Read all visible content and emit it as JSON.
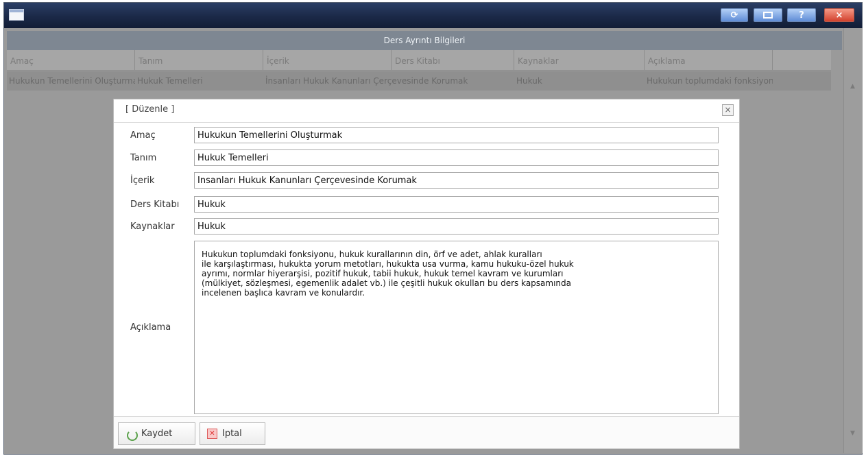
{
  "window": {
    "buttons": {
      "refresh": "⟳",
      "help": "?",
      "close": "×"
    }
  },
  "panel": {
    "title": "Ders Ayrıntı Bilgileri",
    "columns": [
      "Amaç",
      "Tanım",
      "İçerik",
      "Ders Kitabı",
      "Kaynaklar",
      "Açıklama"
    ],
    "rows": [
      [
        "Hukukun Temellerini Oluşturmak",
        "Hukuk Temelleri",
        "İnsanları Hukuk Kanunları Çerçevesinde Korumak",
        "Hukuk",
        "Hukuk",
        "Hukukun toplumdaki fonksiyonu"
      ]
    ]
  },
  "dialog": {
    "title": "[ Düzenle ]",
    "close": "×",
    "fields": {
      "amac": {
        "label": "Amaç",
        "value": "Hukukun Temellerini Oluşturmak"
      },
      "tanim": {
        "label": "Tanım",
        "value": "Hukuk Temelleri"
      },
      "icerik": {
        "label": "İçerik",
        "value": "İnsanları Hukuk Kanunları Çerçevesinde Korumak"
      },
      "ders_kitabi": {
        "label": "Ders Kitabı",
        "value": "Hukuk"
      },
      "kaynaklar": {
        "label": "Kaynaklar",
        "value": "Hukuk"
      },
      "aciklama": {
        "label": "Açıklama",
        "value": "Hukukun toplumdaki fonksiyonu, hukuk kurallarının din, örf ve adet, ahlak kuralları\nile karşılaştırması, hukukta yorum metotları, hukukta usa vurma, kamu hukuku-özel hukuk\nayrımı, normlar hiyerarşisi, pozitif hukuk, tabii hukuk, hukuk temel kavram ve kurumları\n(mülkiyet, sözleşmesi, egemenlik adalet vb.) ile çeşitli hukuk okulları bu ders kapsamında\nincelenen başlıca kavram ve konulardır."
      }
    },
    "buttons": {
      "save": "Kaydet",
      "cancel": "Iptal"
    }
  },
  "colors": {
    "titlebar": "#1b2947",
    "overlay": "#9a9a9a",
    "header": "#7e8792",
    "close_button": "#d2412d"
  }
}
